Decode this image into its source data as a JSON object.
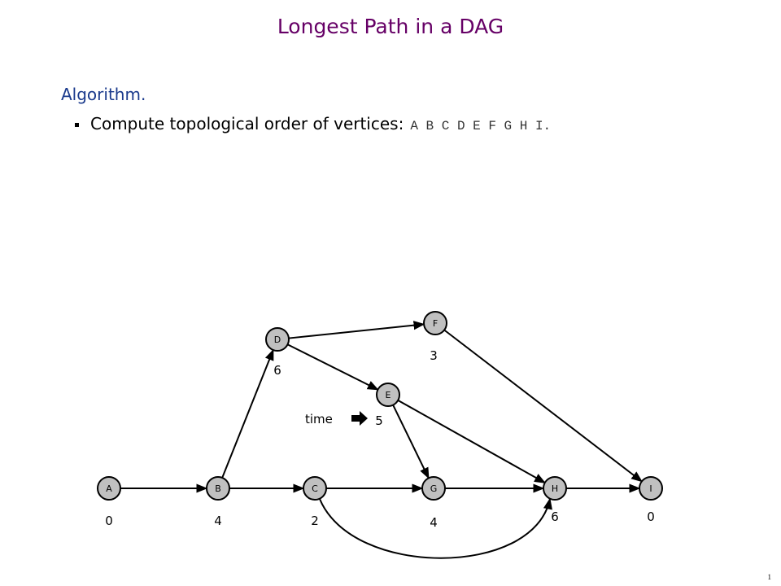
{
  "title": "Longest Path in a DAG",
  "heading": "Algorithm.",
  "bullet": {
    "text": "Compute topological order of vertices:",
    "order": "A B C D E F G H I."
  },
  "graph": {
    "nodes": [
      {
        "id": "A",
        "weight": "0"
      },
      {
        "id": "B",
        "weight": "4"
      },
      {
        "id": "C",
        "weight": "2"
      },
      {
        "id": "D",
        "weight": "6"
      },
      {
        "id": "E",
        "weight": "5"
      },
      {
        "id": "F",
        "weight": "3"
      },
      {
        "id": "G",
        "weight": "4"
      },
      {
        "id": "H",
        "weight": "6"
      },
      {
        "id": "I",
        "weight": "0"
      }
    ],
    "edges": [
      [
        "A",
        "B"
      ],
      [
        "B",
        "C"
      ],
      [
        "B",
        "D"
      ],
      [
        "C",
        "G"
      ],
      [
        "C",
        "H"
      ],
      [
        "D",
        "F"
      ],
      [
        "D",
        "E"
      ],
      [
        "E",
        "G"
      ],
      [
        "E",
        "H"
      ],
      [
        "F",
        "I"
      ],
      [
        "G",
        "H"
      ],
      [
        "H",
        "I"
      ]
    ],
    "time_label": "time",
    "node_fill": "#c0c0c0"
  },
  "page_number": "1"
}
